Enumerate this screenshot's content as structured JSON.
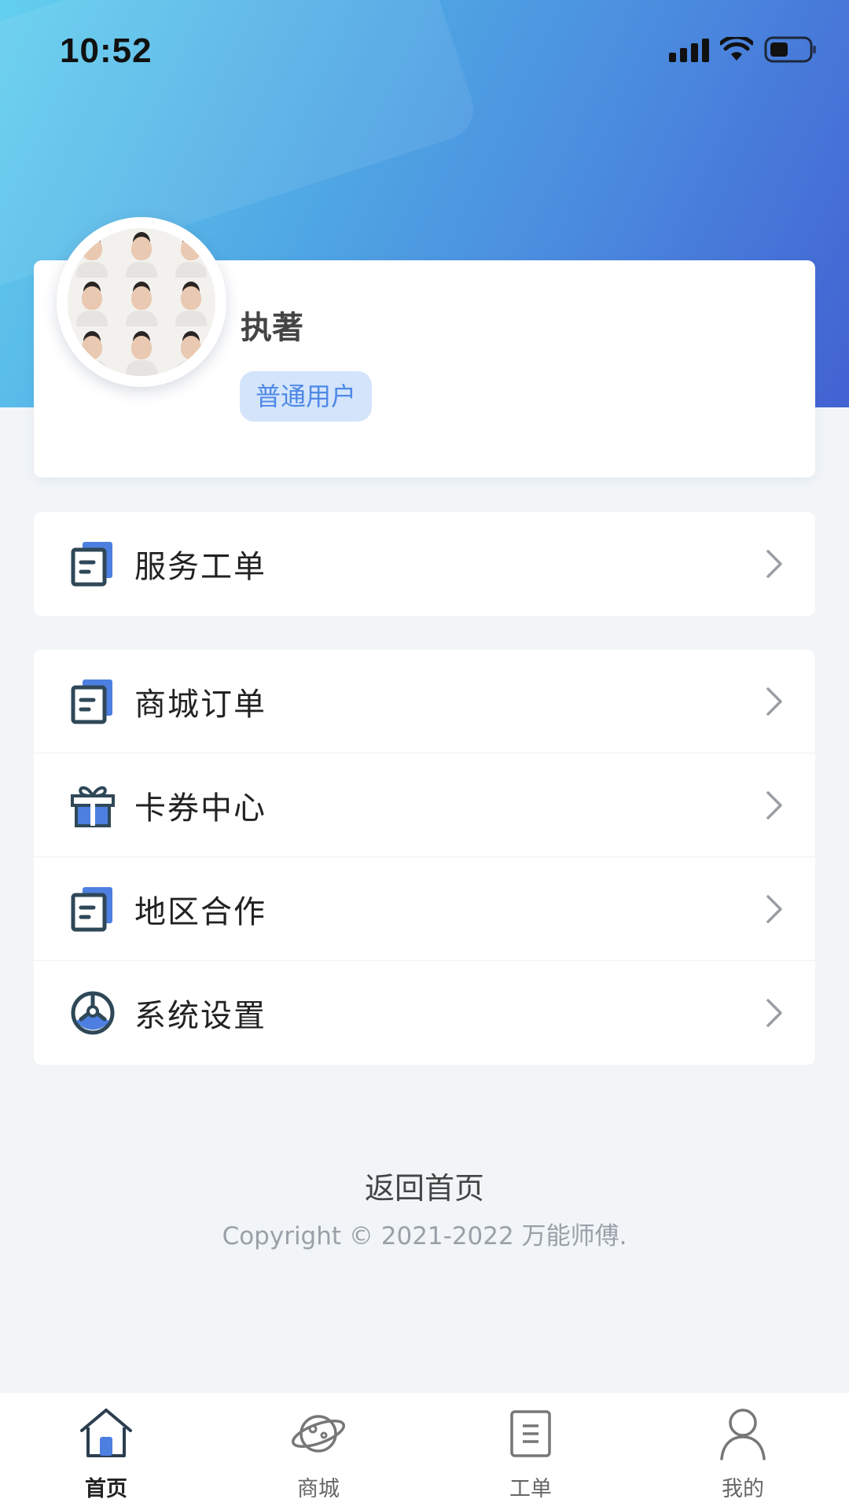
{
  "status_bar": {
    "time": "10:52"
  },
  "profile": {
    "name": "执著",
    "badge": "普通用户"
  },
  "menu_group_1": [
    {
      "label": "服务工单",
      "icon": "document-icon"
    }
  ],
  "menu_group_2": [
    {
      "label": "商城订单",
      "icon": "document-icon"
    },
    {
      "label": "卡券中心",
      "icon": "gift-icon"
    },
    {
      "label": "地区合作",
      "icon": "document-icon"
    },
    {
      "label": "系统设置",
      "icon": "settings-icon"
    }
  ],
  "footer": {
    "back_home": "返回首页",
    "copyright": "Copyright © 2021-2022 万能师傅."
  },
  "tabbar": {
    "items": [
      {
        "label": "首页",
        "icon": "home-icon",
        "active": true
      },
      {
        "label": "商城",
        "icon": "planet-icon",
        "active": false
      },
      {
        "label": "工单",
        "icon": "worksheet-icon",
        "active": false
      },
      {
        "label": "我的",
        "icon": "user-icon",
        "active": false
      }
    ]
  },
  "colors": {
    "accent": "#4d88e6",
    "badge_bg": "#d3e4fb",
    "icon_dark": "#2f4858",
    "icon_blue": "#4c7fe0"
  }
}
